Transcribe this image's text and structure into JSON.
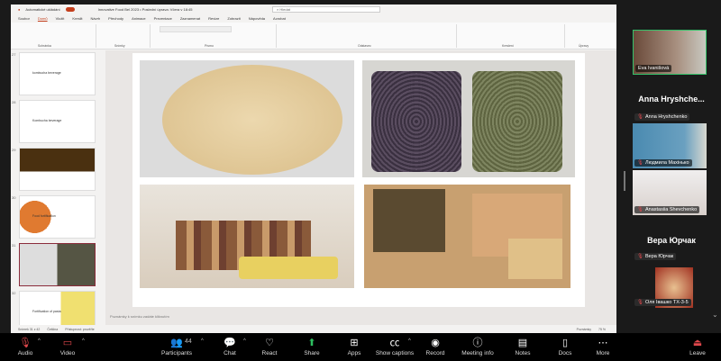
{
  "powerpoint": {
    "autosave_label": "Automatické ukládání",
    "doc_title": "Innovative Food Bel 2023 • Poslední úprava: Včera v 18:45",
    "search_placeholder": "Hledat",
    "tabs": [
      "Soubor",
      "Domů",
      "Vložit",
      "Kreslit",
      "Návrh",
      "Přechody",
      "Animace",
      "Prezentace",
      "Zaznamenat",
      "Revize",
      "Zobrazit",
      "Nápověda",
      "Acrobat"
    ],
    "active_tab": "Domů",
    "ribbon_groups": [
      "Schránka",
      "Snímky",
      "Písmo",
      "Odstavec",
      "Kreslení",
      "Úpravy"
    ],
    "slide_numbers": [
      "27",
      "28",
      "29",
      "30",
      "31",
      "32"
    ],
    "thumb_texts": [
      "kombucha beverage",
      "Kombucha beverage",
      "",
      "Food fortification",
      "",
      "Fortification of pasta"
    ],
    "notes_placeholder": "Poznámky k snímku zadáte kliknutím",
    "status_left": "Snímek 31 z 42",
    "status_lang": "Čeština",
    "status_access": "Přístupnost: prověřte",
    "status_notes": "Poznámky",
    "zoom_level": "75 %"
  },
  "participants_panel": {
    "tiles": [
      {
        "name": "Eva Ivanišová",
        "muted": false,
        "active_speaker": true
      },
      {
        "name": "Людмила Махінько",
        "muted": true
      },
      {
        "name": "Anastasiia Shevchenko",
        "muted": true
      },
      {
        "name": "Оля Івашко ТХ-3-5",
        "muted": true
      }
    ],
    "no_video": [
      {
        "display_name": "Anna  Hryshche...",
        "tag": "Anna Hryshchenko"
      },
      {
        "display_name": "Вера Юрчак",
        "tag": "Вера Юрчак"
      }
    ]
  },
  "toolbar": {
    "audio": "Audio",
    "video": "Video",
    "participants": "Participants",
    "participants_count": "44",
    "chat": "Chat",
    "react": "React",
    "share": "Share",
    "apps": "Apps",
    "captions": "Show captions",
    "record": "Record",
    "meeting_info": "Meeting info",
    "notes": "Notes",
    "docs": "Docs",
    "more": "More",
    "leave": "Leave"
  },
  "colors": {
    "share": "#2dbe60",
    "muted": "#e0474c",
    "active_speaker": "#35c26a",
    "ppt_accent": "#c43e1c"
  }
}
